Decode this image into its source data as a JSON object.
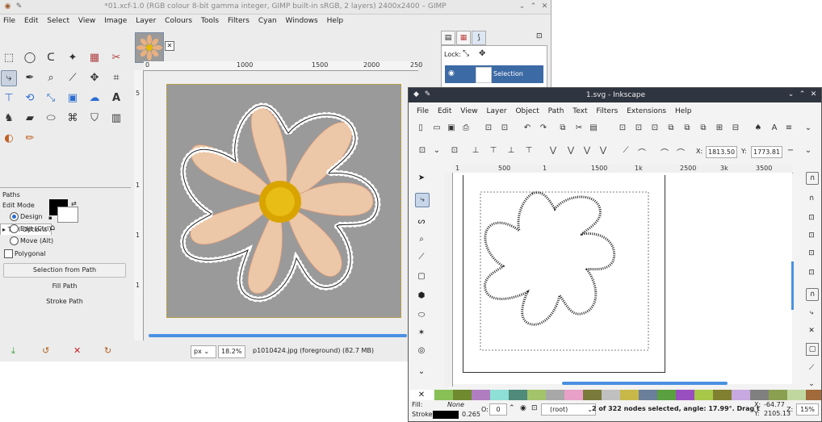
{
  "gimp": {
    "title": "*01.xcf-1.0 (RGB colour 8-bit gamma integer, GIMP built-in sRGB, 2 layers) 2400x2400 – GIMP",
    "menu": [
      "File",
      "Edit",
      "Select",
      "View",
      "Image",
      "Layer",
      "Colours",
      "Tools",
      "Filters",
      "Cyan",
      "Windows",
      "Help"
    ],
    "ruler_labels": [
      "0",
      "1000",
      "1500",
      "2000",
      "250"
    ],
    "vruler_labels": [
      "5",
      "1",
      "1",
      "1"
    ],
    "tool_options": {
      "tab_label": "Tool Options",
      "heading": "Paths",
      "edit_mode": "Edit Mode",
      "modes": [
        "Design",
        "Edit (Ctrl)",
        "Move (Alt)"
      ],
      "selected_mode": "Design",
      "polygonal": "Polygonal",
      "btn_selection": "Selection from Path",
      "btn_fill": "Fill Path",
      "btn_stroke": "Stroke Path"
    },
    "status": {
      "unit": "px",
      "zoom": "18.2%",
      "info": "p1010424.jpg (foreground) (82.7 MB)"
    },
    "layers": {
      "lock_label": "Lock:",
      "layer_name": "Selection"
    },
    "colors": {
      "fg": "#000000",
      "bg": "#ffffff",
      "accent": "#4a90e2"
    }
  },
  "inkscape": {
    "title": "1.svg - Inkscape",
    "menu": [
      "File",
      "Edit",
      "View",
      "Layer",
      "Object",
      "Path",
      "Text",
      "Filters",
      "Extensions",
      "Help"
    ],
    "x_label": "X:",
    "x_value": "1813.50",
    "y_label": "Y:",
    "y_value": "1773.81",
    "ruler_labels": [
      "1",
      "500",
      "1",
      "1500",
      "1k",
      "2500",
      "3k",
      "3500"
    ],
    "status": {
      "fill_label": "Fill:",
      "fill_value": "None",
      "stroke_label": "Stroke:",
      "stroke_width": "0.265",
      "opacity_label": "O:",
      "opacity_value": "0",
      "layer": "(root)",
      "message": "2 of 322 nodes selected, angle: 17.99°. Drag t",
      "xcoord_label": "X:",
      "xcoord": "-64.77",
      "ycoord_label": "Y:",
      "ycoord": "2105.13",
      "zoom_label": "Z:",
      "zoom": "15%"
    },
    "palette": [
      "#88c057",
      "#6f8a2f",
      "#b07ec0",
      "#8ee0d6",
      "#4f8a7a",
      "#a3c46a",
      "#a8a8a8",
      "#e8a0c8",
      "#7a7a3a",
      "#c0c0c0",
      "#c8b84a",
      "#6a7f9a",
      "#5aa040",
      "#9a4fc0",
      "#a8c84a",
      "#808030",
      "#c8a8e0",
      "#808080",
      "#8aa050",
      "#c0d8a0",
      "#a06a3a"
    ]
  }
}
